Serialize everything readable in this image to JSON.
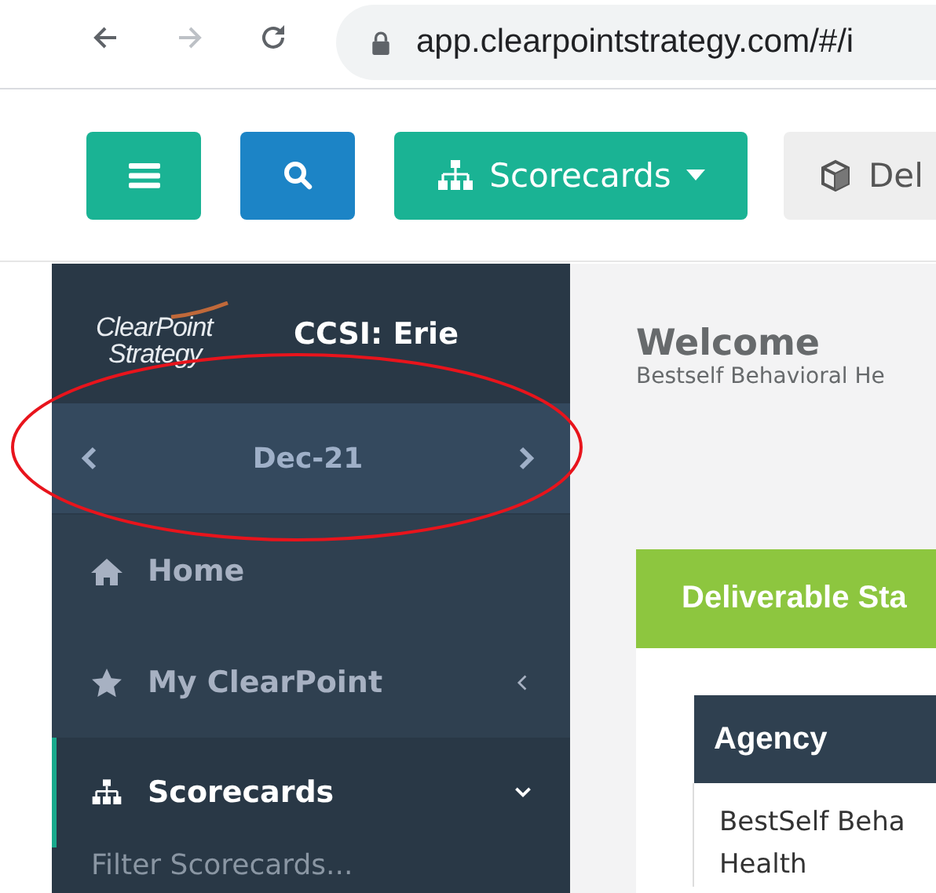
{
  "browser": {
    "url": "app.clearpointstrategy.com/#/i"
  },
  "toolbar": {
    "buttons": [
      {
        "kind": "menu"
      },
      {
        "kind": "search"
      },
      {
        "kind": "scorecards",
        "label": "Scorecards"
      },
      {
        "kind": "deliverables",
        "label": "Del"
      }
    ]
  },
  "sidebar": {
    "logo": {
      "line1": "ClearPoint",
      "line2": "Strategy"
    },
    "account": "CCSI: Erie",
    "period": "Dec-21",
    "items": [
      {
        "kind": "home",
        "label": "Home",
        "selected": false
      },
      {
        "kind": "favorites",
        "label": "My ClearPoint",
        "expanded": false,
        "selected": false
      },
      {
        "kind": "scorecards",
        "label": "Scorecards",
        "expanded": true,
        "selected": true
      }
    ],
    "filter": {
      "placeholder": "Filter Scorecards..."
    }
  },
  "main": {
    "title": "Welcome",
    "subtitle": "Bestself Behavioral He",
    "panel": {
      "title": "Deliverable Sta"
    },
    "table": {
      "columns": [
        "Agency"
      ],
      "rows": [
        [
          "BestSelf Beha\nHealth"
        ]
      ]
    }
  },
  "annotations": [
    {
      "kind": "ellipse"
    }
  ]
}
